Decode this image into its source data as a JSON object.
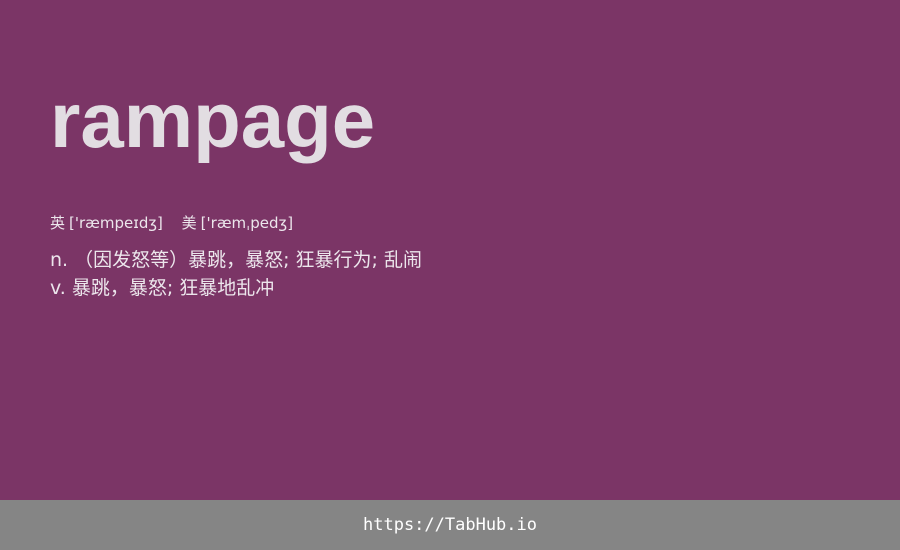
{
  "card": {
    "word": "rampage",
    "pronunciations": [
      {
        "label": "英",
        "ipa": "['ræmpeɪdʒ]"
      },
      {
        "label": "美",
        "ipa": "['ræmˌpedʒ]"
      }
    ],
    "definitions": [
      {
        "pos": "n.",
        "text": "（因发怒等）暴跳，暴怒; 狂暴行为; 乱闹"
      },
      {
        "pos": "v.",
        "text": "暴跳，暴怒; 狂暴地乱冲"
      }
    ]
  },
  "footer": {
    "url": "https://TabHub.io"
  },
  "colors": {
    "background": "#7b3566",
    "footer": "#858585",
    "word": "#e2dde2"
  }
}
